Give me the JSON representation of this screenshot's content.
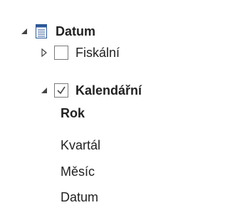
{
  "tree": {
    "root": {
      "label": "Datum",
      "icon": "table-icon",
      "expanded": true
    },
    "fiscal": {
      "label": "Fiskální",
      "checked": false,
      "expanded": false
    },
    "calendar": {
      "label": "Kalendářní",
      "checked": true,
      "expanded": true,
      "levels": [
        "Rok",
        "Kvartál",
        "Měsíc",
        "Datum"
      ]
    }
  },
  "colors": {
    "text": "#222222",
    "caret": "#444444",
    "checkbox_border": "#7a7a7a",
    "icon_blue": "#2b5797"
  }
}
